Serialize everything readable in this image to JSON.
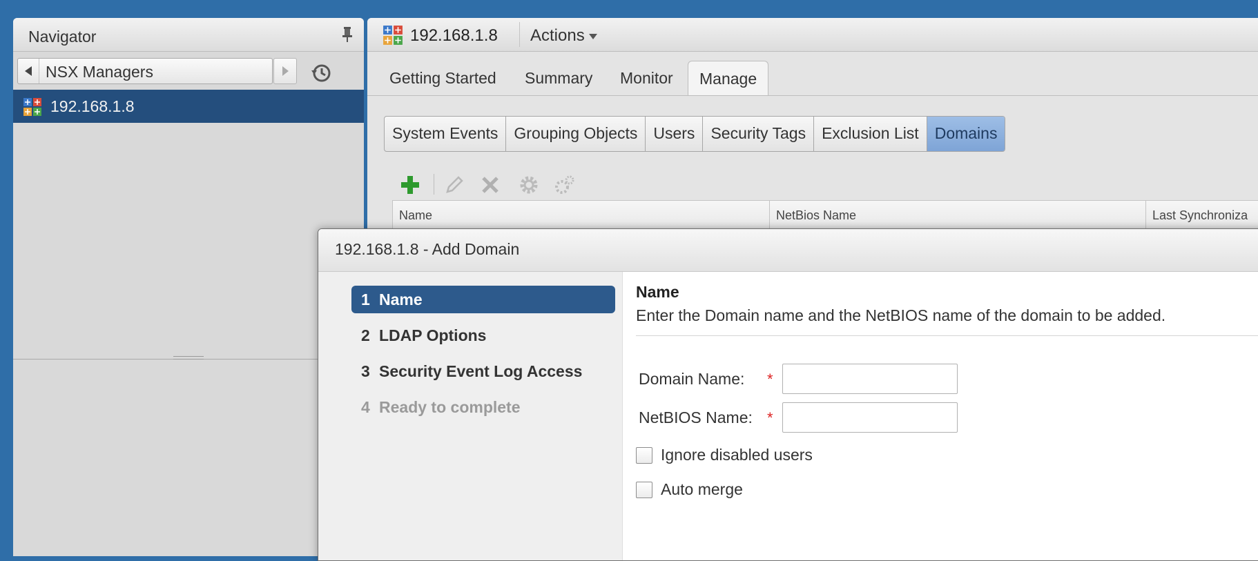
{
  "navigator": {
    "title": "Navigator",
    "breadcrumb": "NSX Managers",
    "selected_item": "192.168.1.8"
  },
  "main": {
    "host_title": "192.168.1.8",
    "actions_label": "Actions",
    "tabs": [
      {
        "label": "Getting Started"
      },
      {
        "label": "Summary"
      },
      {
        "label": "Monitor"
      },
      {
        "label": "Manage",
        "active": true
      }
    ],
    "subtabs": [
      {
        "label": "System Events"
      },
      {
        "label": "Grouping Objects"
      },
      {
        "label": "Users"
      },
      {
        "label": "Security Tags"
      },
      {
        "label": "Exclusion List"
      },
      {
        "label": "Domains",
        "active": true
      }
    ],
    "grid_columns": [
      "Name",
      "NetBios Name",
      "Last Synchroniza"
    ]
  },
  "dialog": {
    "title": "192.168.1.8 - Add Domain",
    "steps": [
      {
        "num": "1",
        "label": "Name",
        "state": "active"
      },
      {
        "num": "2",
        "label": "LDAP Options",
        "state": "normal"
      },
      {
        "num": "3",
        "label": "Security Event Log Access",
        "state": "normal"
      },
      {
        "num": "4",
        "label": "Ready to complete",
        "state": "disabled"
      }
    ],
    "section_title": "Name",
    "section_desc": "Enter the Domain name and the NetBIOS name of the domain to be added.",
    "domain_label": "Domain Name:",
    "domain_value": "",
    "netbios_label": "NetBIOS Name:",
    "netbios_value": "",
    "required_marker": "*",
    "ignore_disabled_label": "Ignore disabled users",
    "ignore_disabled_checked": false,
    "auto_merge_label": "Auto merge",
    "auto_merge_checked": false
  },
  "colors": {
    "selection": "#244e7d",
    "active_step": "#2d5a8c",
    "active_subtab": "#8eb2e0",
    "required": "#d22222",
    "add_icon": "#2e9a2e"
  }
}
